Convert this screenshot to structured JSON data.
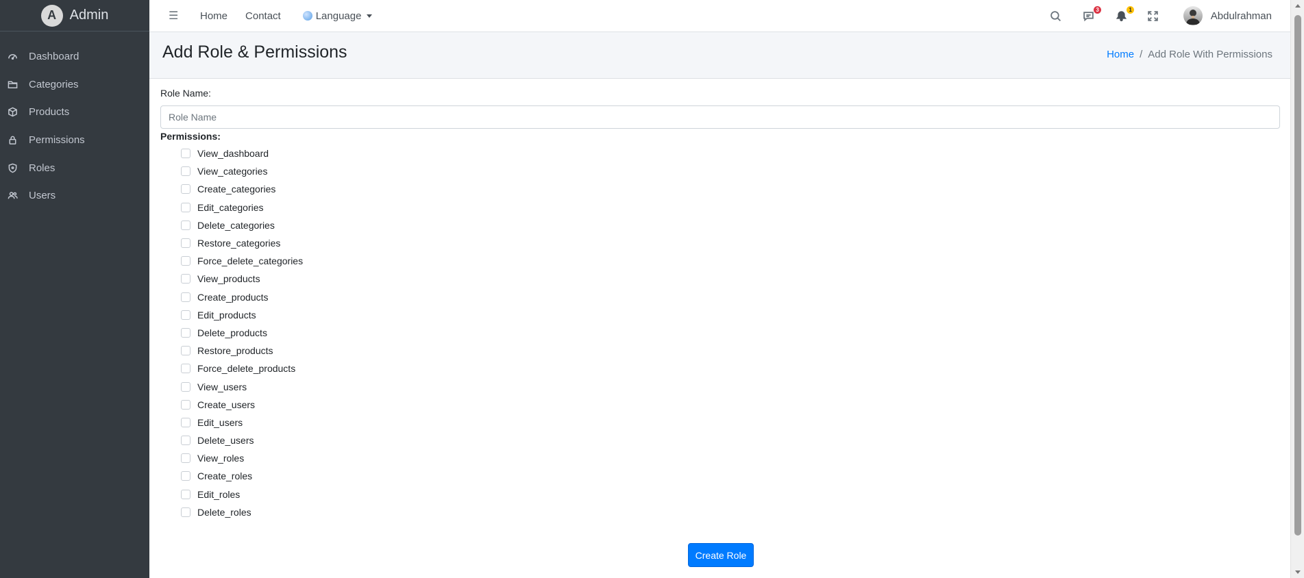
{
  "sidebar": {
    "brand": "Admin",
    "brand_logo_letter": "A",
    "items": [
      {
        "label": "Dashboard",
        "icon": "gauge-icon"
      },
      {
        "label": "Categories",
        "icon": "folder-icon"
      },
      {
        "label": "Products",
        "icon": "box-icon"
      },
      {
        "label": "Permissions",
        "icon": "lock-icon"
      },
      {
        "label": "Roles",
        "icon": "shield-icon"
      },
      {
        "label": "Users",
        "icon": "users-icon"
      }
    ]
  },
  "topbar": {
    "menu_icon": "☰",
    "links": [
      "Home",
      "Contact"
    ],
    "language": "Language",
    "messages_count": "3",
    "notifications_count": "1",
    "username": "Abdulrahman"
  },
  "header": {
    "title": "Add Role & Permissions",
    "breadcrumb": {
      "home": "Home",
      "separator": "/",
      "current": "Add Role With Permissions"
    }
  },
  "form": {
    "role_label": "Role Name:",
    "role_placeholder": "Role Name",
    "permissions_label": "Permissions:",
    "permissions": [
      "View_dashboard",
      "View_categories",
      "Create_categories",
      "Edit_categories",
      "Delete_categories",
      "Restore_categories",
      "Force_delete_categories",
      "View_products",
      "Create_products",
      "Edit_products",
      "Delete_products",
      "Restore_products",
      "Force_delete_products",
      "View_users",
      "Create_users",
      "Edit_users",
      "Delete_users",
      "View_roles",
      "Create_roles",
      "Edit_roles",
      "Delete_roles"
    ],
    "submit_label": "Create Role"
  },
  "colors": {
    "sidebar_bg": "#343a40",
    "primary": "#007bff",
    "badge_danger": "#dc3545",
    "badge_warning": "#ffc107"
  }
}
